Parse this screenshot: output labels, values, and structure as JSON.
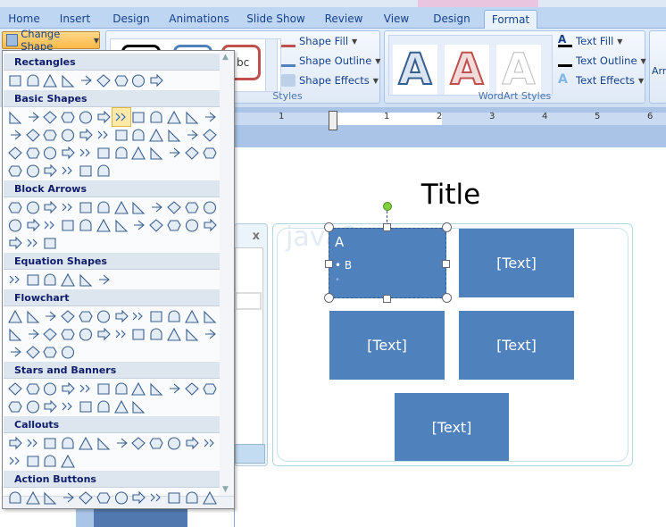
{
  "tabs": [
    "Home",
    "Insert",
    "Design",
    "Animations",
    "Slide Show",
    "Review",
    "View",
    "Design",
    "Format"
  ],
  "active_tab": "Format",
  "ribbon": {
    "change_shape": "Change Shape",
    "shape_styles_label": "Styles",
    "shape_style_sample": "bc",
    "shape_fill": "Shape Fill",
    "shape_outline": "Shape Outline",
    "shape_effects": "Shape Effects",
    "wordart_label": "WordArt Styles",
    "wordart_sample": "A",
    "text_fill": "Text Fill",
    "text_outline": "Text Outline",
    "text_effects": "Text Effects",
    "arrange_partial": "Arra"
  },
  "ruler": [
    "1",
    "1",
    "2",
    "3",
    "4",
    "5",
    "6"
  ],
  "shapes_menu": {
    "sections": [
      {
        "title": "Rectangles",
        "rows": [
          9
        ]
      },
      {
        "title": "Basic Shapes",
        "rows": [
          12,
          12,
          12,
          6
        ]
      },
      {
        "title": "Block Arrows",
        "rows": [
          12,
          12,
          3
        ]
      },
      {
        "title": "Equation Shapes",
        "rows": [
          6
        ]
      },
      {
        "title": "Flowchart",
        "rows": [
          12,
          12,
          4
        ]
      },
      {
        "title": "Stars and Banners",
        "rows": [
          12,
          8
        ]
      },
      {
        "title": "Callouts",
        "rows": [
          12,
          4
        ]
      },
      {
        "title": "Action Buttons",
        "rows": [
          12
        ]
      }
    ]
  },
  "side_panel": {
    "close": "x"
  },
  "slide": {
    "title": "Title",
    "watermark": "java2s.com",
    "selected_box": {
      "line1": "A",
      "bullet": "B"
    },
    "boxes": [
      "[Text]",
      "[Text]",
      "[Text]",
      "[Text]"
    ]
  },
  "colors": {
    "accent": "#4f81bd",
    "ribbon": "#bfd6f2",
    "highlight": "#fbb848"
  }
}
